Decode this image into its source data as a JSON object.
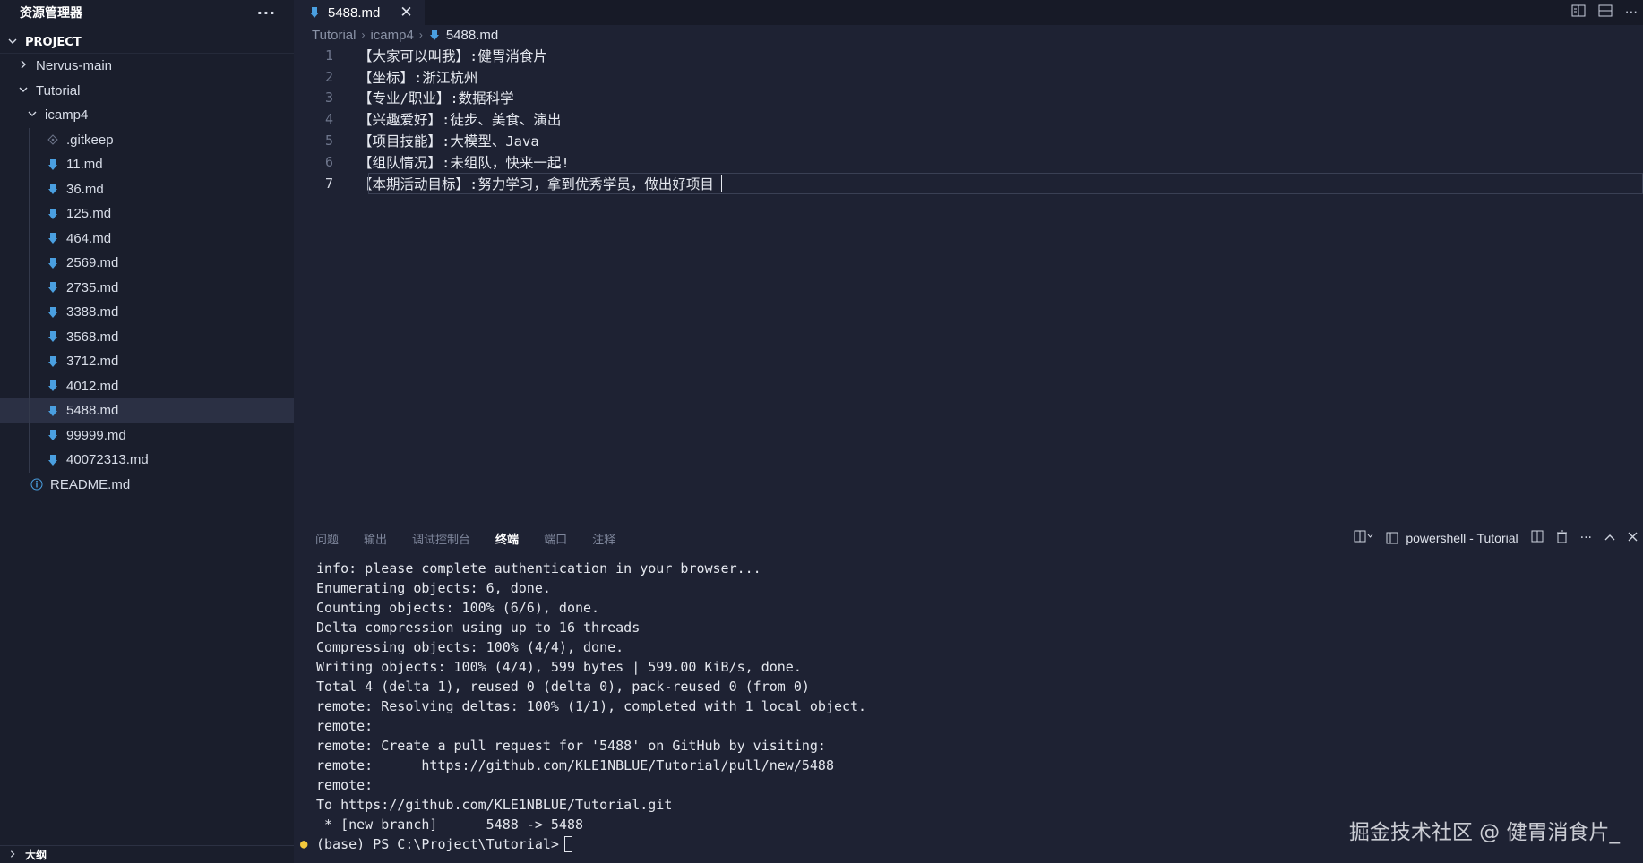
{
  "sidebar": {
    "title": "资源管理器",
    "more_label": "···",
    "section_title": "PROJECT",
    "items": [
      {
        "label": "Nervus-main",
        "type": "folder",
        "expanded": false,
        "depth": 0
      },
      {
        "label": "Tutorial",
        "type": "folder",
        "expanded": true,
        "depth": 0
      },
      {
        "label": "icamp4",
        "type": "folder",
        "expanded": true,
        "depth": 1
      },
      {
        "label": ".gitkeep",
        "type": "file",
        "icon": "gitkeep-icon",
        "depth": 2
      },
      {
        "label": "11.md",
        "type": "file",
        "icon": "markdown-icon",
        "depth": 2
      },
      {
        "label": "36.md",
        "type": "file",
        "icon": "markdown-icon",
        "depth": 2
      },
      {
        "label": "125.md",
        "type": "file",
        "icon": "markdown-icon",
        "depth": 2
      },
      {
        "label": "464.md",
        "type": "file",
        "icon": "markdown-icon",
        "depth": 2
      },
      {
        "label": "2569.md",
        "type": "file",
        "icon": "markdown-icon",
        "depth": 2
      },
      {
        "label": "2735.md",
        "type": "file",
        "icon": "markdown-icon",
        "depth": 2
      },
      {
        "label": "3388.md",
        "type": "file",
        "icon": "markdown-icon",
        "depth": 2
      },
      {
        "label": "3568.md",
        "type": "file",
        "icon": "markdown-icon",
        "depth": 2
      },
      {
        "label": "3712.md",
        "type": "file",
        "icon": "markdown-icon",
        "depth": 2
      },
      {
        "label": "4012.md",
        "type": "file",
        "icon": "markdown-icon",
        "depth": 2
      },
      {
        "label": "5488.md",
        "type": "file",
        "icon": "markdown-icon",
        "depth": 2,
        "active": true
      },
      {
        "label": "99999.md",
        "type": "file",
        "icon": "markdown-icon",
        "depth": 2
      },
      {
        "label": "40072313.md",
        "type": "file",
        "icon": "markdown-icon",
        "depth": 2
      },
      {
        "label": "README.md",
        "type": "file",
        "icon": "info-icon",
        "depth": 1
      }
    ],
    "outline_label": "大纲"
  },
  "editor": {
    "tab_label": "5488.md",
    "close_label": "✕",
    "breadcrumb": [
      "Tutorial",
      "icamp4",
      "5488.md"
    ],
    "lines": [
      {
        "num": "1",
        "text": "【大家可以叫我】:健胃消食片"
      },
      {
        "num": "2",
        "text": "【坐标】:浙江杭州"
      },
      {
        "num": "3",
        "text": "【专业/职业】:数据科学"
      },
      {
        "num": "4",
        "text": "【兴趣爱好】:徒步、美食、演出"
      },
      {
        "num": "5",
        "text": "【项目技能】:大模型、Java"
      },
      {
        "num": "6",
        "text": "【组队情况】:未组队，快来一起!"
      },
      {
        "num": "7",
        "text": "【本期活动目标】:努力学习，拿到优秀学员，做出好项目"
      }
    ],
    "current_line": 7
  },
  "panel": {
    "tabs": [
      "问题",
      "输出",
      "调试控制台",
      "终端",
      "端口",
      "注释"
    ],
    "active_tab": "终端",
    "terminal_name": "powershell - Tutorial",
    "output": [
      "info: please complete authentication in your browser...",
      "Enumerating objects: 6, done.",
      "Counting objects: 100% (6/6), done.",
      "Delta compression using up to 16 threads",
      "Compressing objects: 100% (4/4), done.",
      "Writing objects: 100% (4/4), 599 bytes | 599.00 KiB/s, done.",
      "Total 4 (delta 1), reused 0 (delta 0), pack-reused 0 (from 0)",
      "remote: Resolving deltas: 100% (1/1), completed with 1 local object.",
      "remote:",
      "remote: Create a pull request for '5488' on GitHub by visiting:",
      "remote:      https://github.com/KLE1NBLUE/Tutorial/pull/new/5488",
      "remote:",
      "To https://github.com/KLE1NBLUE/Tutorial.git",
      " * [new branch]      5488 -> 5488"
    ],
    "prompt": "(base) PS C:\\Project\\Tutorial>"
  },
  "watermark": "掘金技术社区 @ 健胃消食片_",
  "colors": {
    "markdown_icon": "#4a9fe0",
    "bulb": "#f3c93c",
    "background": "#1e2233",
    "sidebar_bg": "#1a1e2c"
  }
}
